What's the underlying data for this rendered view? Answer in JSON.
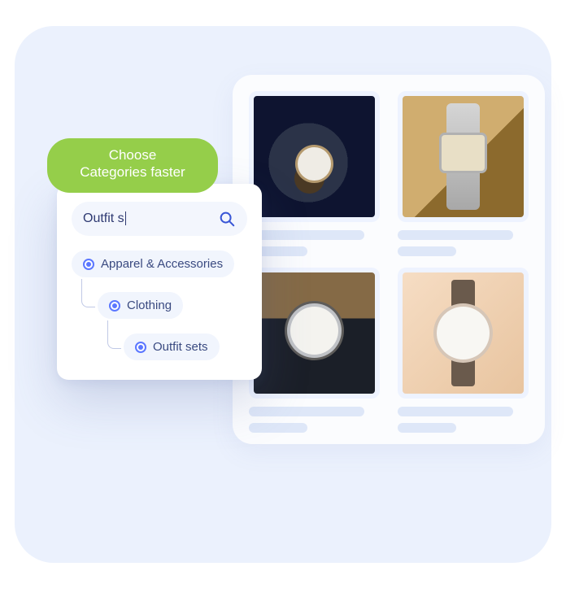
{
  "badge": {
    "line1": "Choose",
    "line2": "Categories faster"
  },
  "search": {
    "value": "Outfit s"
  },
  "categories": [
    {
      "label": "Apparel & Accessories",
      "level": 0
    },
    {
      "label": "Clothing",
      "level": 1
    },
    {
      "label": "Outfit sets",
      "level": 2
    }
  ],
  "products": [
    {
      "name": "watch-dark-leather"
    },
    {
      "name": "watch-digital-silver"
    },
    {
      "name": "watch-analog-silver"
    },
    {
      "name": "watch-beige-strap"
    }
  ],
  "colors": {
    "accent_green": "#95ce4a",
    "accent_blue": "#5b77ff"
  }
}
